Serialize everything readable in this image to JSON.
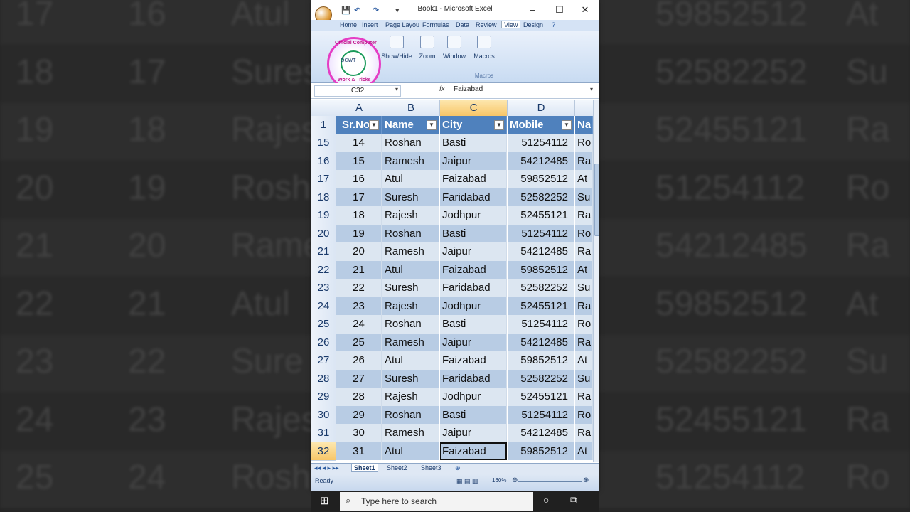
{
  "window": {
    "title": "Book1 - Microsoft Excel",
    "controls": {
      "minimize": "–",
      "maximize": "☐",
      "close": "✕"
    }
  },
  "ribbon": {
    "tabs": [
      "Home",
      "Insert",
      "Page Layou",
      "Formulas",
      "Data",
      "Review",
      "View",
      "Design"
    ],
    "active_tab": "View",
    "groups": [
      {
        "label": "Show/Hide"
      },
      {
        "label": "Zoom"
      },
      {
        "label": "Window"
      },
      {
        "label": "Macros"
      }
    ],
    "macros_group_label": "Macros",
    "logo": {
      "top_text": "Official Computer",
      "bottom_text": "Work & Tricks",
      "center_text": "OCWT"
    }
  },
  "formula_bar": {
    "name_box": "C32",
    "fx": "fx",
    "value": "Faizabad"
  },
  "grid": {
    "columns": [
      "A",
      "B",
      "C",
      "D"
    ],
    "selected_column": "C",
    "header_row_number": "1",
    "headers": [
      "Sr.No",
      "Name",
      "City",
      "Mobile",
      "Na"
    ],
    "rows": [
      {
        "n": "15",
        "sr": "14",
        "name": "Roshan",
        "city": "Basti",
        "mobile": "51254112",
        "na": "Ro"
      },
      {
        "n": "16",
        "sr": "15",
        "name": "Ramesh",
        "city": "Jaipur",
        "mobile": "54212485",
        "na": "Ra"
      },
      {
        "n": "17",
        "sr": "16",
        "name": "Atul",
        "city": "Faizabad",
        "mobile": "59852512",
        "na": "At"
      },
      {
        "n": "18",
        "sr": "17",
        "name": "Suresh",
        "city": "Faridabad",
        "mobile": "52582252",
        "na": "Su"
      },
      {
        "n": "19",
        "sr": "18",
        "name": "Rajesh",
        "city": "Jodhpur",
        "mobile": "52455121",
        "na": "Ra"
      },
      {
        "n": "20",
        "sr": "19",
        "name": "Roshan",
        "city": "Basti",
        "mobile": "51254112",
        "na": "Ro"
      },
      {
        "n": "21",
        "sr": "20",
        "name": "Ramesh",
        "city": "Jaipur",
        "mobile": "54212485",
        "na": "Ra"
      },
      {
        "n": "22",
        "sr": "21",
        "name": "Atul",
        "city": "Faizabad",
        "mobile": "59852512",
        "na": "At"
      },
      {
        "n": "23",
        "sr": "22",
        "name": "Suresh",
        "city": "Faridabad",
        "mobile": "52582252",
        "na": "Su"
      },
      {
        "n": "24",
        "sr": "23",
        "name": "Rajesh",
        "city": "Jodhpur",
        "mobile": "52455121",
        "na": "Ra"
      },
      {
        "n": "25",
        "sr": "24",
        "name": "Roshan",
        "city": "Basti",
        "mobile": "51254112",
        "na": "Ro"
      },
      {
        "n": "26",
        "sr": "25",
        "name": "Ramesh",
        "city": "Jaipur",
        "mobile": "54212485",
        "na": "Ra"
      },
      {
        "n": "27",
        "sr": "26",
        "name": "Atul",
        "city": "Faizabad",
        "mobile": "59852512",
        "na": "At"
      },
      {
        "n": "28",
        "sr": "27",
        "name": "Suresh",
        "city": "Faridabad",
        "mobile": "52582252",
        "na": "Su"
      },
      {
        "n": "29",
        "sr": "28",
        "name": "Rajesh",
        "city": "Jodhpur",
        "mobile": "52455121",
        "na": "Ra"
      },
      {
        "n": "30",
        "sr": "29",
        "name": "Roshan",
        "city": "Basti",
        "mobile": "51254112",
        "na": "Ro"
      },
      {
        "n": "31",
        "sr": "30",
        "name": "Ramesh",
        "city": "Jaipur",
        "mobile": "54212485",
        "na": "Ra"
      },
      {
        "n": "32",
        "sr": "31",
        "name": "Atul",
        "city": "Faizabad",
        "mobile": "59852512",
        "na": "At"
      }
    ],
    "active_row": "32"
  },
  "sheets": {
    "tabs": [
      "Sheet1",
      "Sheet2",
      "Sheet3"
    ],
    "active": "Sheet1"
  },
  "status": {
    "ready": "Ready",
    "zoom": "160%"
  },
  "taskbar": {
    "search_placeholder": "Type here to search"
  },
  "background": {
    "rows": [
      {
        "n": "17",
        "sr": "16",
        "name": "Atul",
        "mobile": "59852512",
        "na": "At"
      },
      {
        "n": "18",
        "sr": "17",
        "name": "Sures",
        "mobile": "52582252",
        "na": "Su"
      },
      {
        "n": "19",
        "sr": "18",
        "name": "Rajes",
        "mobile": "52455121",
        "na": "Ra"
      },
      {
        "n": "20",
        "sr": "19",
        "name": "Rosh",
        "mobile": "51254112",
        "na": "Ro"
      },
      {
        "n": "21",
        "sr": "20",
        "name": "Rame",
        "mobile": "54212485",
        "na": "Ra"
      },
      {
        "n": "22",
        "sr": "21",
        "name": "Atul",
        "mobile": "59852512",
        "na": "At"
      },
      {
        "n": "23",
        "sr": "22",
        "name": "Sure",
        "mobile": "52582252",
        "na": "Su"
      },
      {
        "n": "24",
        "sr": "23",
        "name": "Rajes",
        "mobile": "52455121",
        "na": "Ra"
      },
      {
        "n": "25",
        "sr": "24",
        "name": "Rosh",
        "mobile": "51254112",
        "na": "Ro"
      }
    ]
  },
  "colors": {
    "header_blue": "#4f81bd",
    "row_light": "#dce6f1",
    "row_dark": "#b8cce4",
    "selection_orange": "#f8c668"
  }
}
